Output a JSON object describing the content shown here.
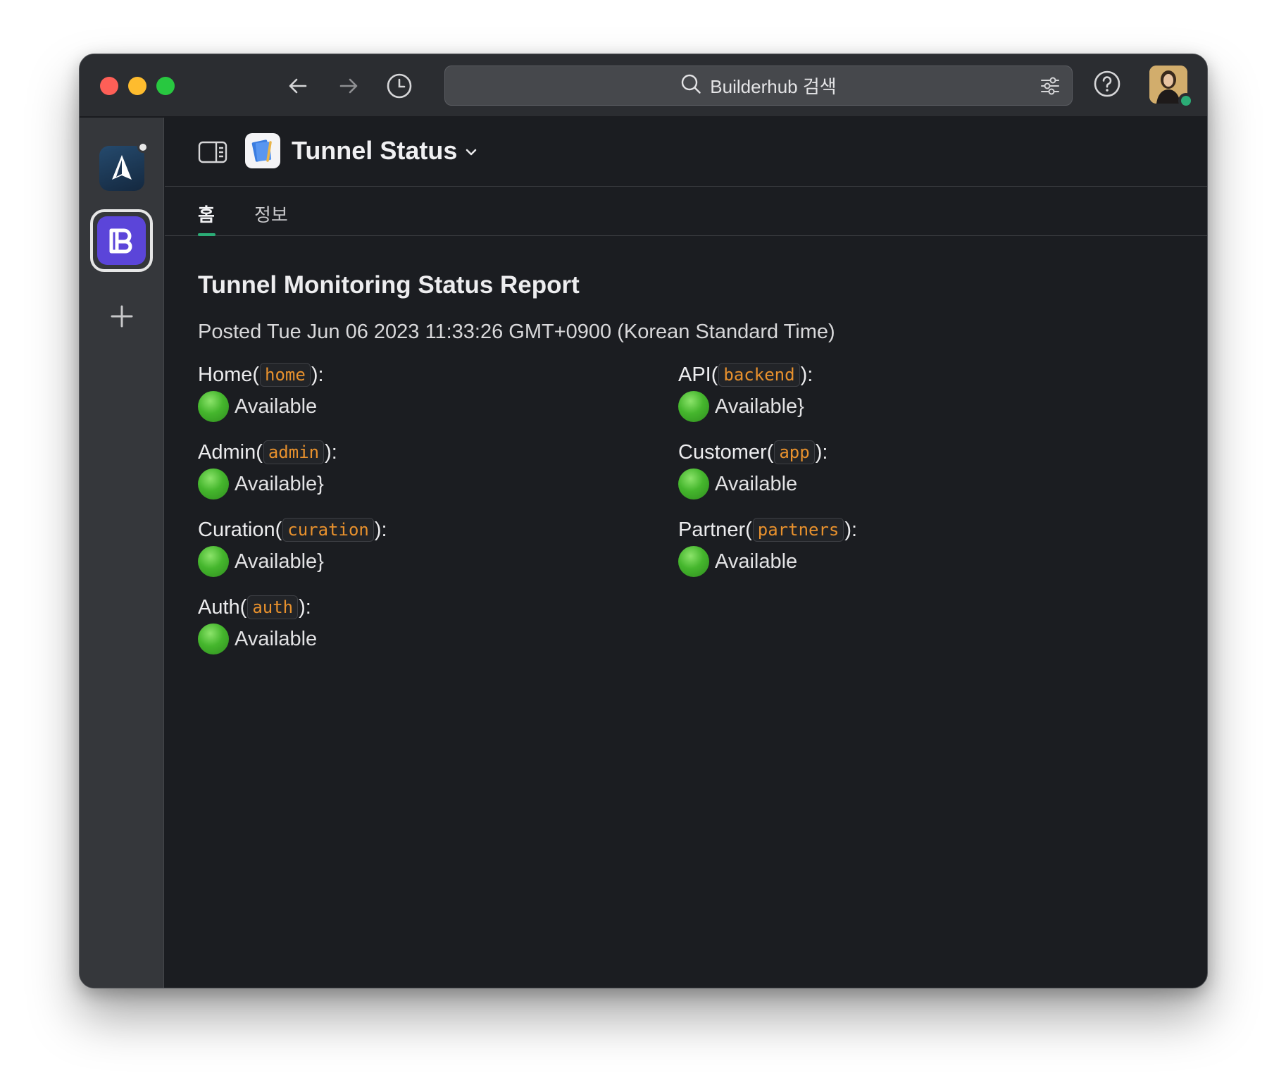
{
  "search": {
    "placeholder": "Builderhub 검색"
  },
  "channel": {
    "title": "Tunnel Status"
  },
  "tabs": [
    {
      "label": "홈",
      "active": true
    },
    {
      "label": "정보",
      "active": false
    }
  ],
  "report": {
    "title": "Tunnel Monitoring Status Report",
    "posted": "Posted Tue Jun 06 2023 11:33:26 GMT+0900 (Korean Standard Time)",
    "items": [
      {
        "name": "Home(",
        "code": "home",
        "suffix": "):",
        "status": "Available"
      },
      {
        "name": "API(",
        "code": "backend",
        "suffix": "):",
        "status": "Available}"
      },
      {
        "name": "Admin(",
        "code": "admin",
        "suffix": "):",
        "status": "Available}"
      },
      {
        "name": "Customer(",
        "code": "app",
        "suffix": "):",
        "status": "Available"
      },
      {
        "name": "Curation(",
        "code": "curation",
        "suffix": "):",
        "status": "Available}"
      },
      {
        "name": "Partner(",
        "code": "partners",
        "suffix": "):",
        "status": "Available"
      },
      {
        "name": "Auth(",
        "code": "auth",
        "suffix": "):",
        "status": "Available"
      }
    ]
  },
  "colors": {
    "status_green": "#45b62d",
    "code_orange": "#e8912d",
    "tab_accent": "#2bac76",
    "workspace_purple": "#5b45d9"
  },
  "icons": [
    "back-arrow-icon",
    "forward-arrow-icon",
    "history-icon",
    "search-icon",
    "filter-icon",
    "help-icon",
    "sidebar-toggle-icon",
    "add-workspace-icon",
    "chevron-down-icon",
    "green-circle-icon"
  ]
}
